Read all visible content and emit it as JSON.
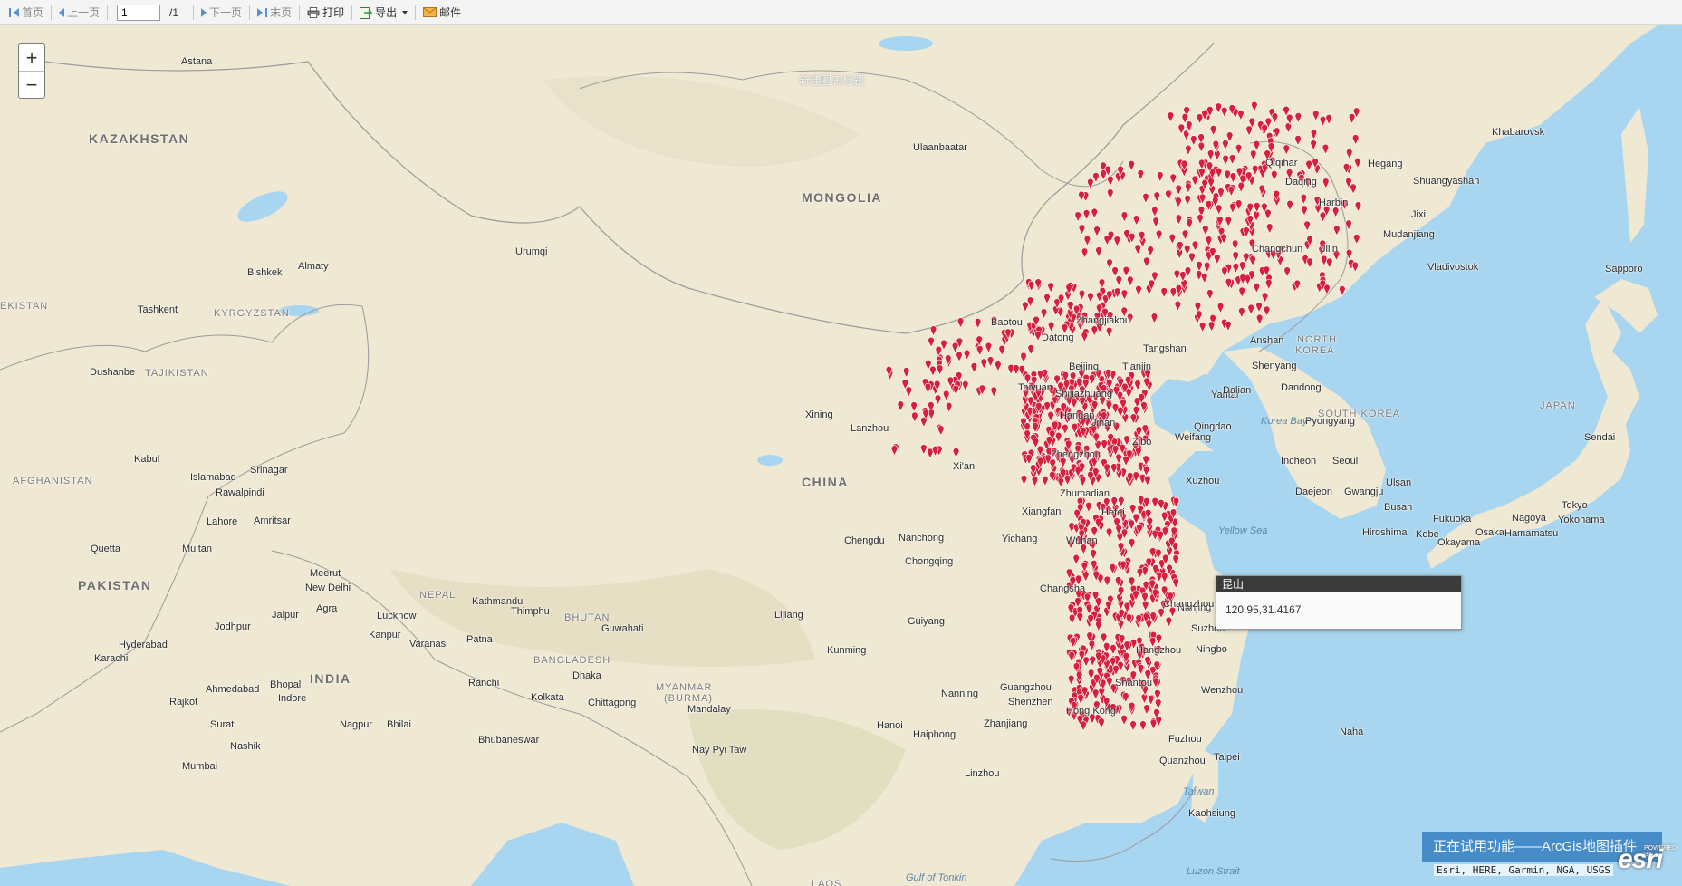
{
  "toolbar": {
    "first_label": "首页",
    "prev_label": "上一页",
    "page_value": "1",
    "page_total": "/1",
    "next_label": "下一页",
    "last_label": "末页",
    "print_label": "打印",
    "export_label": "导出",
    "mail_label": "邮件"
  },
  "map": {
    "overlay_title": "新建图表标题",
    "colors": {
      "land": "#efe8d3",
      "water": "#a6d4ef",
      "marker": "#d6203d",
      "border": "#8f8f8f"
    },
    "countries": [
      "KAZAKHSTAN",
      "MONGOLIA",
      "KYRGYZSTAN",
      "TAJIKISTAN",
      "AFGHANISTAN",
      "PAKISTAN",
      "INDIA",
      "CHINA",
      "NEPAL",
      "BHUTAN",
      "BANGLADESH",
      "MYANMAR",
      "(BURMA)",
      "NORTH",
      "KOREA",
      "SOUTH KOREA",
      "JAPAN",
      "EKISTAN",
      "LAOS"
    ],
    "cities": [
      "Astana",
      "Ulaanbaatar",
      "Khabarovsk",
      "Qiqihar",
      "Hegang",
      "Daqing",
      "Shuangyashan",
      "Harbin",
      "Jixi",
      "Mudanjiang",
      "Changchun",
      "Jilin",
      "Vladivostok",
      "Sapporo",
      "Urumqi",
      "Bishkek",
      "Almaty",
      "Tashkent",
      "Dushanbe",
      "Kabul",
      "Islamabad",
      "Srinagar",
      "Rawalpindi",
      "Lahore",
      "Amritsar",
      "Quetta",
      "Multan",
      "Meerut",
      "New Delhi",
      "Jodhpur",
      "Jaipur",
      "Agra",
      "Lucknow",
      "Kanpur",
      "Varanasi",
      "Patna",
      "Hyderabad",
      "Karachi",
      "Ahmedabad",
      "Bhopal",
      "Indore",
      "Rajkot",
      "Surat",
      "Nagpur",
      "Bhilai",
      "Nashik",
      "Mumbai",
      "Kathmandu",
      "Thimphu",
      "Guwahati",
      "Ranchi",
      "Dhaka",
      "Kolkata",
      "Chittagong",
      "Mandalay",
      "Nay Pyi Taw",
      "Bhubaneswar",
      "Xining",
      "Lanzhou",
      "Xi'an",
      "Chengdu",
      "Nanchong",
      "Chongqing",
      "Guiyang",
      "Lijiang",
      "Kunming",
      "Hanoi",
      "Haiphong",
      "Nanning",
      "Guangzhou",
      "Shenzhen",
      "Hong Kong",
      "Zhanjiang",
      "Shantou",
      "Xiangfan",
      "Wuhan",
      "Yichang",
      "Changsha",
      "Hefei",
      "Zhumadian",
      "Zhengzhou",
      "Baotou",
      "Datong",
      "Zhangjiakou",
      "Beijing",
      "Tianjin",
      "Tangshan",
      "Taiyuan",
      "Shijiazhuang",
      "Handan",
      "Jinan",
      "Zibo",
      "Weifang",
      "Yantai",
      "Qingdao",
      "Xuzhou",
      "Nanjing",
      "Suzhou",
      "Changzhou",
      "Hangzhou",
      "Ningbo",
      "Wenzhou",
      "Fuzhou",
      "Quanzhou",
      "Taipei",
      "Kaohsiung",
      "Dalian",
      "Shenyang",
      "Anshan",
      "Dandong",
      "Pyongyang",
      "Incheon",
      "Seoul",
      "Daejeon",
      "Gwangju",
      "Ulsan",
      "Busan",
      "Fukuoka",
      "Hiroshima",
      "Kobe",
      "Osaka",
      "Okayama",
      "Nagoya",
      "Tokyo",
      "Yokohama",
      "Hamamatsu",
      "Sendai",
      "Naha",
      "Linzhou"
    ],
    "water": [
      "Korea Bay",
      "Yellow Sea",
      "Gulf of Tonkin",
      "Luzon Strait",
      "Taiwan"
    ]
  },
  "zoom": {
    "in_label": "+",
    "out_label": "−"
  },
  "popup": {
    "title": "昆山",
    "coords": "120.95,31.4167"
  },
  "footer": {
    "trial_text": "正在试用功能——ArcGis地图插件",
    "attribution": "Esri, HERE, Garmin, NGA, USGS",
    "logo": "esri",
    "logo_small": "POWERED BY"
  }
}
